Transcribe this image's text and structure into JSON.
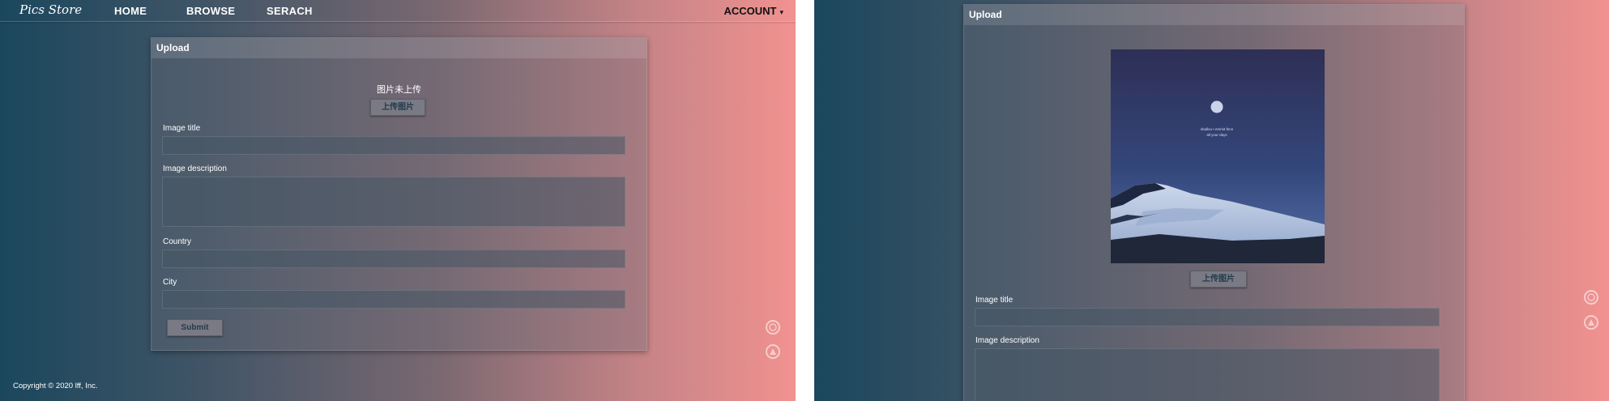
{
  "nav": {
    "logo": "Pics Store",
    "home": "HOME",
    "browse": "BROWSE",
    "search": "SERACH",
    "account": "ACCOUNT",
    "account_caret": "▾"
  },
  "upload_panel": {
    "title": "Upload",
    "no_image_text": "图片未上传",
    "upload_button": "上传图片",
    "fields": {
      "title_label": "Image title",
      "description_label": "Image description",
      "country_label": "Country",
      "city_label": "City"
    },
    "submit_button": "Submit"
  },
  "preview": {
    "caption_line1": "shallou • emmit fenn",
    "caption_line2": "all your days"
  },
  "footer": {
    "copyright": "Copyright © 2020 lff, Inc."
  },
  "icons": [
    "circle-icon",
    "triangle-icon"
  ]
}
